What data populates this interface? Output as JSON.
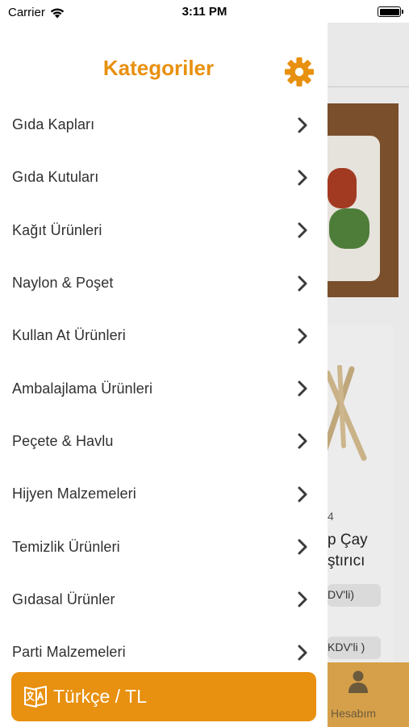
{
  "status_bar": {
    "carrier": "Carrier",
    "time": "3:11 PM"
  },
  "menu": {
    "title": "Kategoriler",
    "settings_icon": "gear-icon",
    "categories": [
      {
        "label": "Gıda Kapları"
      },
      {
        "label": "Gıda Kutuları"
      },
      {
        "label": "Kağıt Ürünleri"
      },
      {
        "label": "Naylon & Poşet"
      },
      {
        "label": "Kullan At Ürünleri"
      },
      {
        "label": "Ambalajlama Ürünleri"
      },
      {
        "label": "Peçete & Havlu"
      },
      {
        "label": "Hijyen Malzemeleri"
      },
      {
        "label": "Temizlik Ürünleri"
      },
      {
        "label": "Gıdasal Ürünler"
      },
      {
        "label": "Parti Malzemeleri"
      }
    ],
    "language_button": {
      "label": "Türkçe / TL",
      "icon": "translate-icon"
    }
  },
  "background": {
    "product_code": "4",
    "product_name_line1": "p Çay",
    "product_name_line2": "ştırıcı",
    "price_pill_1": "DV'li)",
    "price_pill_2": "KDV'li )",
    "tab_label": "Hesabım",
    "tab_icon": "person-icon"
  },
  "colors": {
    "accent": "#e8900f",
    "text": "#303030"
  }
}
